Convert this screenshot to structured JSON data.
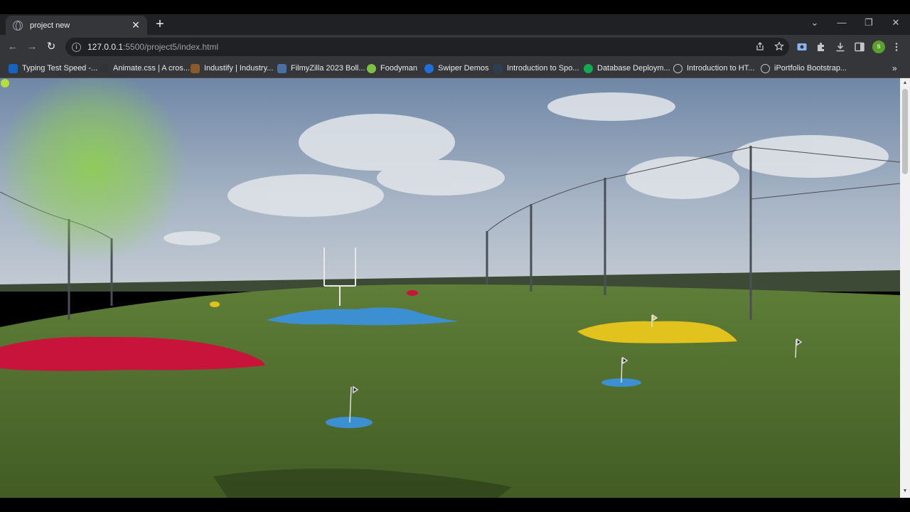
{
  "tab": {
    "title": "project new",
    "close": "✕"
  },
  "new_tab": "+",
  "window_controls": {
    "chevron": "⌄",
    "minimize": "—",
    "restore": "❐",
    "close": "✕"
  },
  "nav": {
    "back": "←",
    "forward": "→",
    "reload": "↻"
  },
  "address_bar": {
    "host": "127.0.0.1",
    "path": ":5500/project5/index.html",
    "info": "i"
  },
  "toolbar_icons": [
    "share-icon",
    "star-icon",
    "screen-capture-icon",
    "extensions-icon",
    "download-icon",
    "side-panel-icon",
    "profile-avatar",
    "menu-icon"
  ],
  "profile_initial": "s",
  "bookmarks": [
    {
      "label": "Typing Test Speed -...",
      "icon_color": "#1565c0"
    },
    {
      "label": "Animate.css | A cros...",
      "icon_color": "#333333"
    },
    {
      "label": "Industify | Industry...",
      "icon_color": "#8a5a2b"
    },
    {
      "label": "FilmyZilla 2023 Boll...",
      "icon_color": "#4a6fa5"
    },
    {
      "label": "Foodyman",
      "icon_color": "#7cc242"
    },
    {
      "label": "Swiper Demos",
      "icon_color": "#1e6fd9"
    },
    {
      "label": "Introduction to Spo...",
      "icon_color": "#2c3e50"
    },
    {
      "label": "Database Deploym...",
      "icon_color": "#13aa52"
    },
    {
      "label": "Introduction to HT...",
      "icon_color": "#888888"
    },
    {
      "label": "iPortfolio Bootstrap...",
      "icon_color": "#888888"
    }
  ],
  "bookmarks_more": "»",
  "scene": {
    "description_colors": {
      "sky": "#8fa3bd",
      "grass": "#4f6e2c",
      "red_target": "#c8143a",
      "blue_target": "#3c8fd0",
      "yellow_target": "#e2c21d",
      "cursor_glow": "#8ed14b"
    }
  }
}
